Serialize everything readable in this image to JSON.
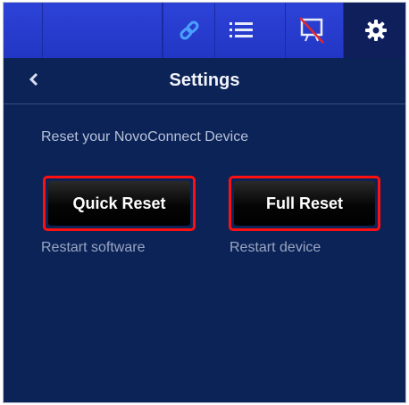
{
  "toolbar": {
    "icons": [
      "link-icon",
      "list-icon",
      "display-off-icon",
      "gear-icon"
    ],
    "colors": {
      "bar": "#2236c4",
      "active": "#0f1f5c",
      "link_icon": "#4aa0ff"
    }
  },
  "header": {
    "back_icon": "chevron-left-icon",
    "title": "Settings"
  },
  "main": {
    "section_text": "Reset your NovoConnect Device",
    "quick_reset": {
      "label": "Quick Reset",
      "caption": "Restart software"
    },
    "full_reset": {
      "label": "Full Reset",
      "caption": "Restart device"
    },
    "colors": {
      "background": "#0c2357",
      "highlight": "#ff1010"
    }
  }
}
